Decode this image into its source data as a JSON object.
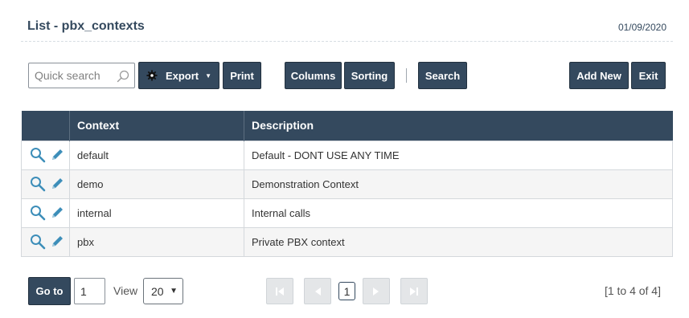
{
  "header": {
    "title": "List - pbx_contexts",
    "date": "01/09/2020"
  },
  "toolbar": {
    "search_placeholder": "Quick search",
    "export_label": "Export",
    "print_label": "Print",
    "columns_label": "Columns",
    "sorting_label": "Sorting",
    "search_label": "Search",
    "add_new_label": "Add New",
    "exit_label": "Exit"
  },
  "table": {
    "columns": [
      "Context",
      "Description"
    ],
    "rows": [
      {
        "context": "default",
        "description": "Default - DONT USE ANY TIME"
      },
      {
        "context": "demo",
        "description": "Demonstration Context"
      },
      {
        "context": "internal",
        "description": "Internal calls"
      },
      {
        "context": "pbx",
        "description": "Private PBX context"
      }
    ]
  },
  "footer": {
    "goto_label": "Go to",
    "goto_value": "1",
    "view_label": "View",
    "view_value": "20",
    "current_page": "1",
    "range": "[1 to 4 of 4]"
  },
  "colors": {
    "accent": "#34495e",
    "icon": "#3d8eb9"
  },
  "icons": [
    "search-icon",
    "gear-icon",
    "caret-down-icon",
    "magnifier-icon",
    "pencil-icon",
    "first-page-icon",
    "prev-page-icon",
    "next-page-icon",
    "last-page-icon"
  ]
}
